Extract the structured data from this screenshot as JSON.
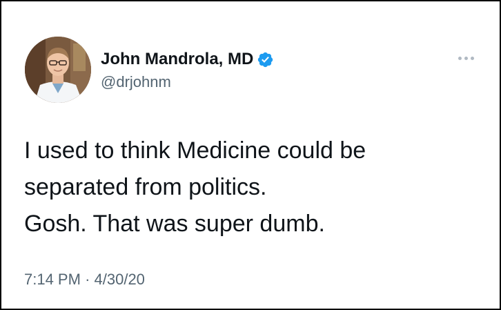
{
  "tweet": {
    "author": {
      "display_name": "John Mandrola, MD",
      "handle": "@drjohnm",
      "verified": true,
      "verified_icon": "verified-badge-icon",
      "verified_color": "#1d9bf0"
    },
    "more_icon": "more-options-icon",
    "text_lines": [
      "I used to think Medicine could be",
      "separated from politics.",
      "Gosh. That was super dumb."
    ],
    "time": "7:14 PM",
    "separator": "·",
    "date": "4/30/20"
  },
  "colors": {
    "text_primary": "#0f1419",
    "text_secondary": "#536471",
    "border": "#000000"
  }
}
